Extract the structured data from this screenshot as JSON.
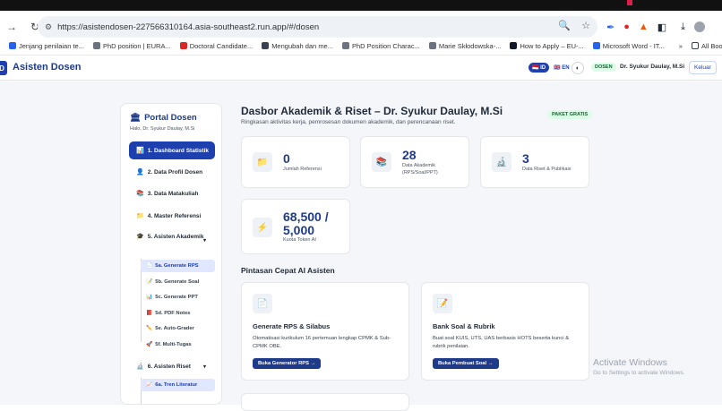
{
  "browser": {
    "url": "https://asistendosen-227566310164.asia-southeast2.run.app/#/dosen",
    "bookmarks": [
      "Jenjang penilaian te...",
      "PhD position | EURA...",
      "Doctoral Candidate...",
      "Mengubah dan me...",
      "PhD Position Charac...",
      "Marie Skłodowska-...",
      "How to Apply – EU-...",
      "Microsoft Word - IT...",
      "All Bookmarks"
    ],
    "bookmark_colors": [
      "#2563eb",
      "#6b7280",
      "#dc2626",
      "#374151",
      "#6b7280",
      "#6b7280",
      "#111827",
      "#2563eb",
      "#374151"
    ]
  },
  "app": {
    "logo_letter": "D",
    "brand": "Asisten Dosen",
    "lang_on": "ID",
    "lang_off": "EN",
    "role_badge": "DOSEN",
    "user_name": "Dr. Syukur Daulay, M.Si",
    "logout_label": "Keluar"
  },
  "sidebar": {
    "title": "Portal Dosen",
    "greeting": "Halo, Dr. Syukur Daulay, M.Si",
    "items": [
      {
        "label": "1. Dashboard Statistik",
        "icon": "📊"
      },
      {
        "label": "2. Data Profil Dosen",
        "icon": "👤"
      },
      {
        "label": "3. Data Matakuliah",
        "icon": "📚"
      },
      {
        "label": "4. Master Referensi",
        "icon": "📁"
      },
      {
        "label": "5. Asisten Akademik",
        "icon": "🎓"
      },
      {
        "label": "6. Asisten Riset",
        "icon": "🔬"
      }
    ],
    "sub5": [
      "5a. Generate RPS",
      "5b. Generate Soal",
      "5c. Generate PPT",
      "5d. PDF Notes",
      "5e. Auto-Grader",
      "5f. Multi-Tugas"
    ],
    "sub5_icons": [
      "📄",
      "📝",
      "📊",
      "📕",
      "✏️",
      "🚀"
    ],
    "sub6": [
      "6a. Tren Literatur"
    ],
    "sub6_icons": [
      "📈"
    ]
  },
  "main": {
    "title": "Dasbor Akademik & Riset – Dr. Syukur Daulay, M.Si",
    "subtitle": "Ringkasan aktivitas kerja, pemrosesan dokumen akademik, dan perencanaan riset.",
    "package_badge": "PAKET GRATIS",
    "stats": [
      {
        "value": "0",
        "label": "Jumlah Referensi",
        "icon": "📁"
      },
      {
        "value": "28",
        "label": "Data Akademik (RPS/Soal/PPT)",
        "icon": "📚"
      },
      {
        "value": "3",
        "label": "Data Riset & Publikasi",
        "icon": "🔬"
      },
      {
        "value": "68,500 / 5,000",
        "label": "Kuota Token AI",
        "icon": "⚡"
      }
    ],
    "shortcuts_title": "Pintasan Cepat AI Asisten",
    "cards": [
      {
        "title": "Generate RPS & Silabus",
        "desc": "Otomatisasi kurikulum 16 pertemuan lengkap CPMK & Sub-CPMK OBE.",
        "button": "Buka Generator RPS →",
        "icon": "📄"
      },
      {
        "title": "Bank Soal & Rubrik",
        "desc": "Buat soal KUIS, UTS, UAS berbasis HOTS beserta kunci & rubrik penilaian.",
        "button": "Buka Pembuat Soal →",
        "icon": "📝"
      }
    ]
  },
  "os": {
    "watermark_title": "Activate Windows",
    "watermark_sub": "Go to Settings to activate Windows."
  }
}
